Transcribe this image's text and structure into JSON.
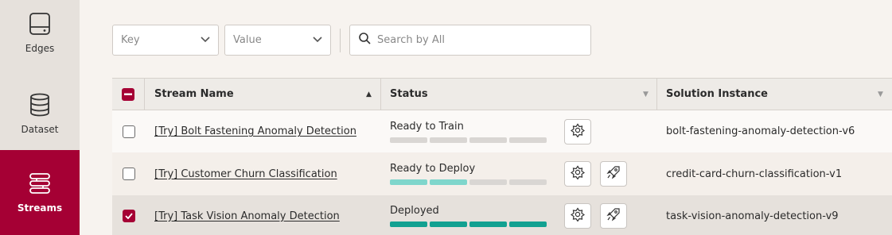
{
  "sidebar": {
    "items": [
      {
        "label": "Edges",
        "icon": "edge-device-icon",
        "active": false
      },
      {
        "label": "Dataset",
        "icon": "database-icon",
        "active": false
      },
      {
        "label": "Streams",
        "icon": "streams-icon",
        "active": true
      }
    ]
  },
  "filters": {
    "key_placeholder": "Key",
    "value_placeholder": "Value",
    "search_placeholder": "Search by All"
  },
  "table": {
    "columns": [
      "Stream Name",
      "Status",
      "Solution Instance"
    ],
    "rows": [
      {
        "name": "[Try] Bolt Fastening Anomaly Detection",
        "status": "Ready to Train",
        "progress_filled": 0,
        "progress_color": "#d9d6d3",
        "instance": "bolt-fastening-anomaly-detection-v6",
        "checked": false,
        "deploy_button": false
      },
      {
        "name": "[Try] Customer Churn Classification",
        "status": "Ready to Deploy",
        "progress_filled": 2,
        "progress_color": "#7fd6cc",
        "instance": "credit-card-churn-classification-v1",
        "checked": false,
        "deploy_button": true
      },
      {
        "name": "[Try] Task Vision Anomaly Detection",
        "status": "Deployed",
        "progress_filled": 4,
        "progress_color": "#12a191",
        "instance": "task-vision-anomaly-detection-v9",
        "checked": true,
        "deploy_button": true
      }
    ]
  },
  "colors": {
    "accent": "#a50034",
    "teal_light": "#7fd6cc",
    "teal": "#12a191"
  }
}
